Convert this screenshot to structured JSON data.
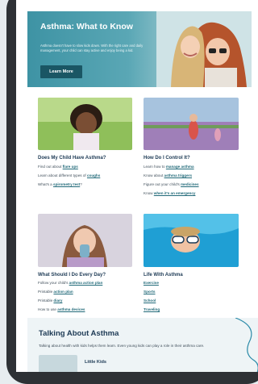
{
  "hero": {
    "title": "Asthma: What to Know",
    "description": "Asthma doesn't have to slow kids down. With the right care and daily management, your child can stay active and enjoy being a kid.",
    "button_label": "Learn More"
  },
  "cards": [
    {
      "title": "Does My Child Have Asthma?",
      "lines": [
        {
          "prefix": "Find out about ",
          "link": "flare ups"
        },
        {
          "prefix": "Learn about different types of ",
          "link": "coughs"
        },
        {
          "prefix": "What's a ",
          "link": "spirometry test",
          "suffix": "?"
        }
      ]
    },
    {
      "title": "How Do I Control It?",
      "lines": [
        {
          "prefix": "Learn how to ",
          "link": "manage asthma"
        },
        {
          "prefix": "Know about ",
          "link": "asthma triggers"
        },
        {
          "prefix": "Figure out your child's ",
          "link": "medicines"
        },
        {
          "prefix": "Know ",
          "link": "when it's an emergency"
        }
      ]
    },
    {
      "title": "What Should I Do Every Day?",
      "lines": [
        {
          "prefix": "Follow your child's ",
          "link": "asthma action plan"
        },
        {
          "prefix": "Printable ",
          "link": "action plan"
        },
        {
          "prefix": "Printable ",
          "link": "diary"
        },
        {
          "prefix": "How to use ",
          "link": "asthma devices"
        }
      ]
    },
    {
      "title": "Life With Asthma",
      "links": [
        "Exercise",
        "Sports",
        "School",
        "Traveling"
      ]
    }
  ],
  "talk": {
    "title": "Talking About Asthma",
    "text": "Talking about health with kids helps them learn. Even young kids can play a role in their asthma care.",
    "subtitle": "Little Kids"
  },
  "colors": {
    "accent": "#1a5664",
    "link": "#236b7a",
    "heading": "#1d3a55"
  }
}
